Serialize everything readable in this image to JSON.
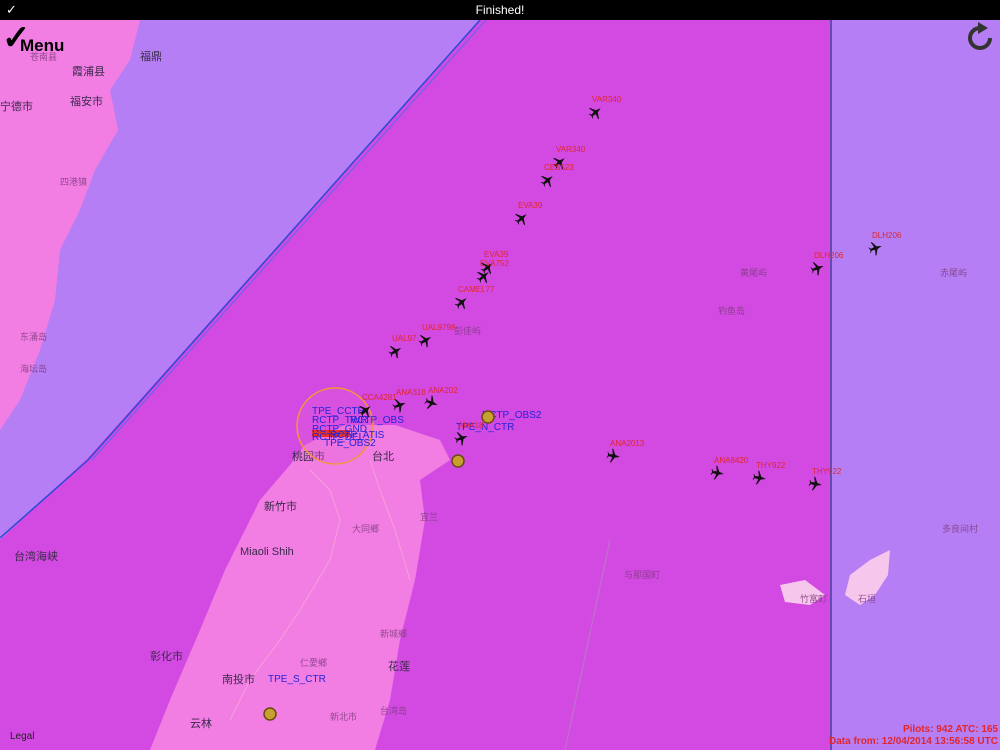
{
  "status_bar": {
    "title": "Finished!",
    "check": "✓"
  },
  "menu": {
    "label": "Menu"
  },
  "legal": "Legal",
  "info": {
    "pilots_atc": "Pilots: 942 ATC: 165",
    "data_from": "Data from: 12/04/2014 13:56:58 UTC"
  },
  "aircraft": [
    {
      "callsign": "VAR340"
    },
    {
      "callsign": "VAR340"
    },
    {
      "callsign": "CES523"
    },
    {
      "callsign": "EVA39"
    },
    {
      "callsign": "EVA39"
    },
    {
      "callsign": "EVA752"
    },
    {
      "callsign": "CAMEL77"
    },
    {
      "callsign": "UAL9798"
    },
    {
      "callsign": "UAL97"
    },
    {
      "callsign": "CCA4281"
    },
    {
      "callsign": "ANA318"
    },
    {
      "callsign": "ANA202"
    },
    {
      "callsign": "ANA18"
    },
    {
      "callsign": "ANA2013"
    },
    {
      "callsign": "ANA8420"
    },
    {
      "callsign": "THY922"
    },
    {
      "callsign": "THY922"
    },
    {
      "callsign": "DLH206"
    },
    {
      "callsign": "DLH206"
    }
  ],
  "atc_labels": [
    {
      "name": "TPE_CCTR"
    },
    {
      "name": "RCTP_TWR"
    },
    {
      "name": "RCTP_GND"
    },
    {
      "name": "RCTP_DEL"
    },
    {
      "name": "RCTP_ATIS"
    },
    {
      "name": "TPE_OBS2"
    },
    {
      "name": "RCTP_OBS"
    },
    {
      "name": "RCTP_OBS2"
    },
    {
      "name": "TPE_N_CTR"
    },
    {
      "name": "TPE_S_CTR"
    }
  ],
  "places": [
    {
      "name": "霞浦县"
    },
    {
      "name": "福安市"
    },
    {
      "name": "宁德市"
    },
    {
      "name": "福鼎"
    },
    {
      "name": "台湾海峡"
    },
    {
      "name": "桃园市"
    },
    {
      "name": "台北"
    },
    {
      "name": "新竹市"
    },
    {
      "name": "Miaoli Shih"
    },
    {
      "name": "彰化市"
    },
    {
      "name": "南投市"
    },
    {
      "name": "云林"
    },
    {
      "name": "花莲"
    },
    {
      "name": "宜兰"
    },
    {
      "name": "大同鄉"
    },
    {
      "name": "新城鄉"
    },
    {
      "name": "赤尾屿"
    },
    {
      "name": "黄尾屿"
    },
    {
      "name": "钓鱼岛"
    },
    {
      "name": "彭佳屿"
    },
    {
      "name": "多良间村"
    },
    {
      "name": "石垣"
    },
    {
      "name": "竹富町"
    },
    {
      "name": "与那国町"
    },
    {
      "name": "东涌岛"
    },
    {
      "name": "海坛岛"
    },
    {
      "name": "苍南县"
    },
    {
      "name": "四港镇"
    },
    {
      "name": "仁愛鄉"
    },
    {
      "name": "台湾岛"
    },
    {
      "name": "新北市"
    }
  ],
  "colors": {
    "fir_magenta": "#d34ae3",
    "fir_lavender": "#b57ef4",
    "land": "#f27ee4",
    "aircraft_label": "#e0262e",
    "atc_label": "#2424d8"
  }
}
